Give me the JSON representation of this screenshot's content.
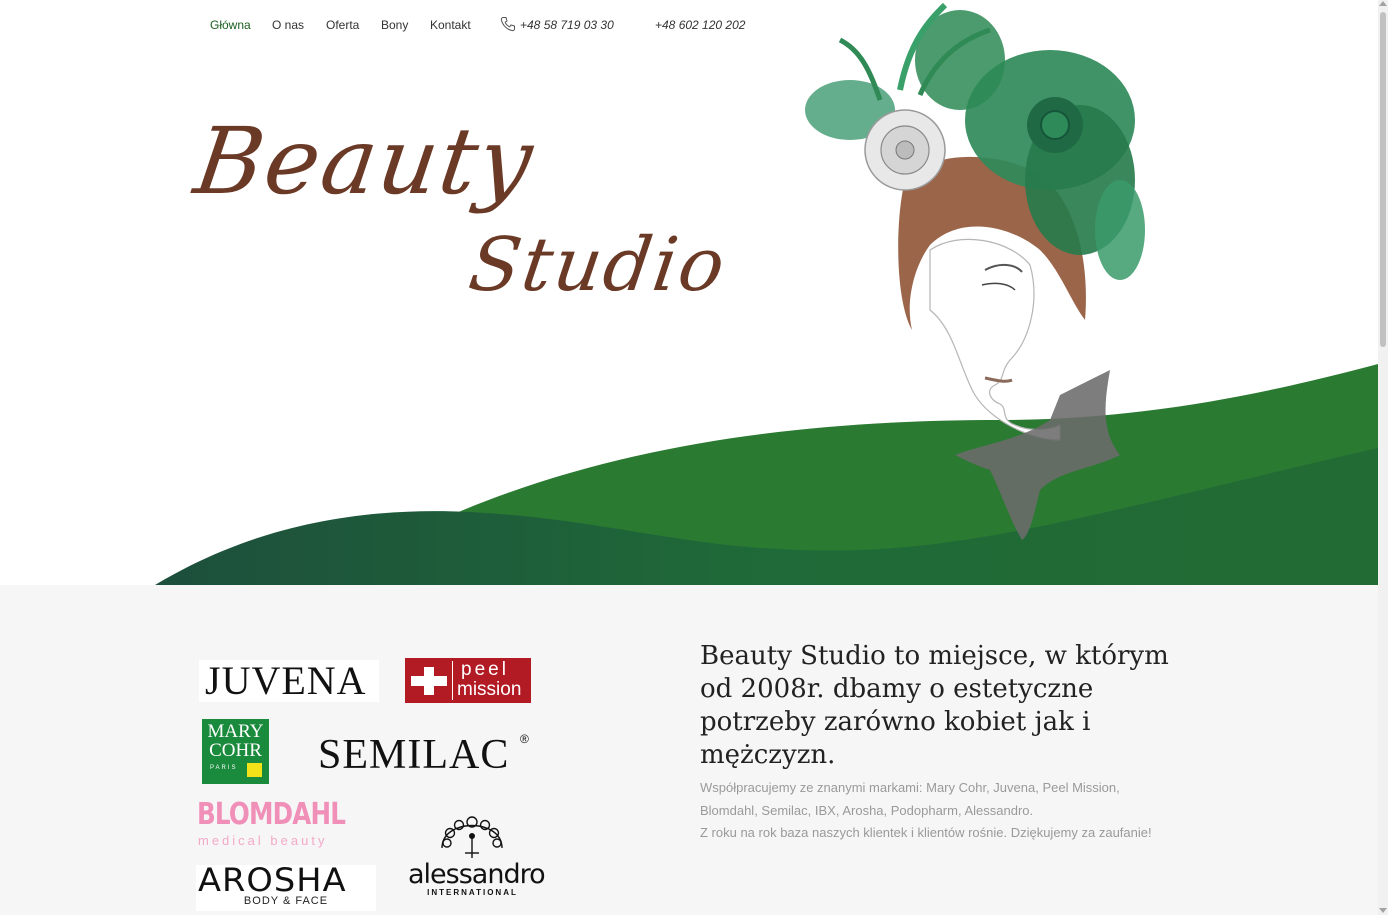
{
  "nav": {
    "items": [
      {
        "label": "Główna",
        "active": true
      },
      {
        "label": "O nas",
        "active": false
      },
      {
        "label": "Oferta",
        "active": false
      },
      {
        "label": "Bony",
        "active": false
      },
      {
        "label": "Kontakt",
        "active": false
      }
    ],
    "phone_icon": "phone-icon",
    "phone1": "+48 58 719 03 30",
    "phone2": "+48 602 120 202"
  },
  "hero": {
    "title_line1": "Beauty",
    "title_line2": "Studio",
    "image": "woman-with-flowers-illustration"
  },
  "brands": {
    "juvena": "JUVENA",
    "peel_mission_top": "peel",
    "peel_mission_bottom": "mission",
    "mary_cohr_line1": "MARY",
    "mary_cohr_line2": "COHR",
    "mary_cohr_line3": "PARIS",
    "semilac": "SEMILAC",
    "blomdahl": "BLOMDAHL",
    "blomdahl_sub": "medical beauty",
    "arosha": "AROSHA",
    "arosha_sub": "BODY & FACE",
    "alessandro": "alessandro",
    "alessandro_sub": "INTERNATIONAL"
  },
  "about": {
    "headline": "Beauty Studio to miejsce, w którym od 2008r. dbamy o estetyczne potrzeby zarówno kobiet jak i mężczyzn.",
    "line1": "Współpracujemy ze znanymi markami: Mary Cohr, Juvena, Peel Mission, Blomdahl, Semilac, IBX, Arosha, Podopharm, Alessandro.",
    "line2": "Z roku na rok baza naszych klientek i klientów rośnie. Dziękujemy za zaufanie!"
  },
  "colors": {
    "green_dark": "#1e5a3a",
    "green_mid": "#226b3a",
    "brown_title": "#6b3a26",
    "juvena_red": "#b31b24",
    "mary_cohr_green": "#1a8a3c",
    "blomdahl_pink": "#f08fb8"
  }
}
